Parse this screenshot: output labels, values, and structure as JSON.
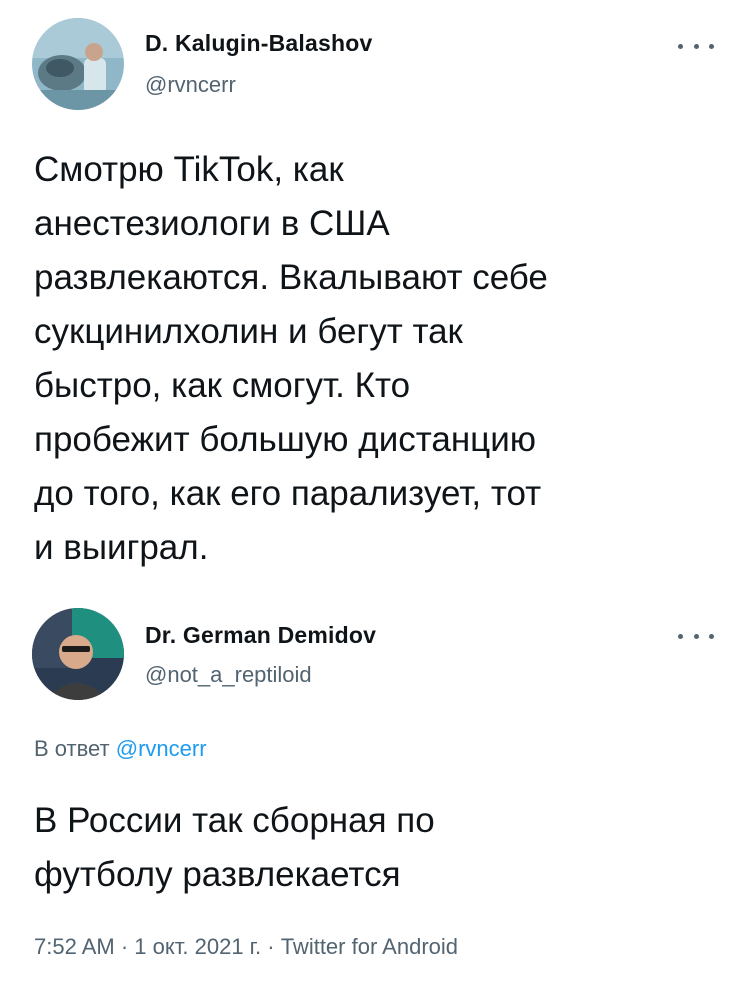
{
  "tweet1": {
    "author_name": "D. Kalugin-Balashov",
    "handle": "@rvncerr",
    "more_icon": "more-horizontal-icon",
    "text": "Смотрю TikTok, как\nанестезиологи в США\nразвлекаются. Вкалывают себе\nсукцинилхолин и бегут так\nбыстро, как смогут. Кто\nпробежит большую дистанцию\nдо того, как его парализует, тот\nи выиграл."
  },
  "tweet2": {
    "author_name": "Dr. German Demidov",
    "handle": "@not_a_reptiloid",
    "more_icon": "more-horizontal-icon",
    "reply_prefix": "В ответ",
    "reply_handle": "@rvncerr",
    "text": "В России так сборная по\nфутболу развлекается",
    "timestamp_time": "7:52 AM",
    "separator": "·",
    "timestamp_date": "1 окт. 2021 г.",
    "source": "Twitter for Android"
  },
  "colors": {
    "text": "#0f1419",
    "secondary": "#536471",
    "link": "#1d9bf0"
  }
}
